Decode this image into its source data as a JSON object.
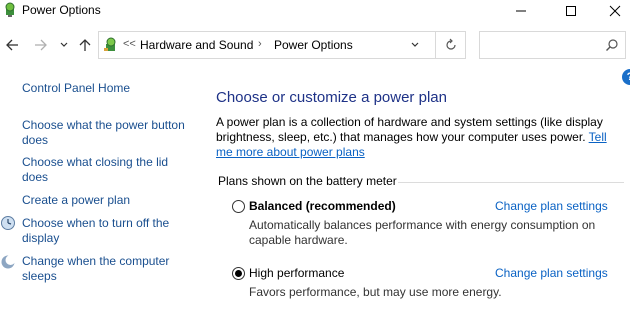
{
  "window": {
    "title": "Power Options"
  },
  "navigation": {
    "breadcrumb_prefix": "<<",
    "breadcrumbs": [
      "Hardware and Sound",
      "Power Options"
    ],
    "search_placeholder": ""
  },
  "sidebar": {
    "items": [
      {
        "label": "Control Panel Home",
        "icon": ""
      },
      {
        "label": "Choose what the power button does",
        "icon": ""
      },
      {
        "label": "Choose what closing the lid does",
        "icon": ""
      },
      {
        "label": "Create a power plan",
        "icon": ""
      },
      {
        "label": "Choose when to turn off the display",
        "icon": "display-icon"
      },
      {
        "label": "Change when the computer sleeps",
        "icon": "moon-icon"
      }
    ]
  },
  "main": {
    "heading": "Choose or customize a power plan",
    "description": "A power plan is a collection of hardware and system settings (like display brightness, sleep, etc.) that manages how your computer uses power.",
    "description_link": "Tell me more about power plans",
    "group_label": "Plans shown on the battery meter",
    "plans": [
      {
        "name": "Balanced (recommended)",
        "selected": false,
        "link": "Change plan settings",
        "description": "Automatically balances performance with energy consumption on capable hardware."
      },
      {
        "name": "High performance",
        "selected": true,
        "link": "Change plan settings",
        "description": "Favors performance, but may use more energy."
      }
    ]
  },
  "colors": {
    "heading": "#1e3287",
    "link": "#0a62c4",
    "sidebar_link": "#1a4f8f"
  }
}
